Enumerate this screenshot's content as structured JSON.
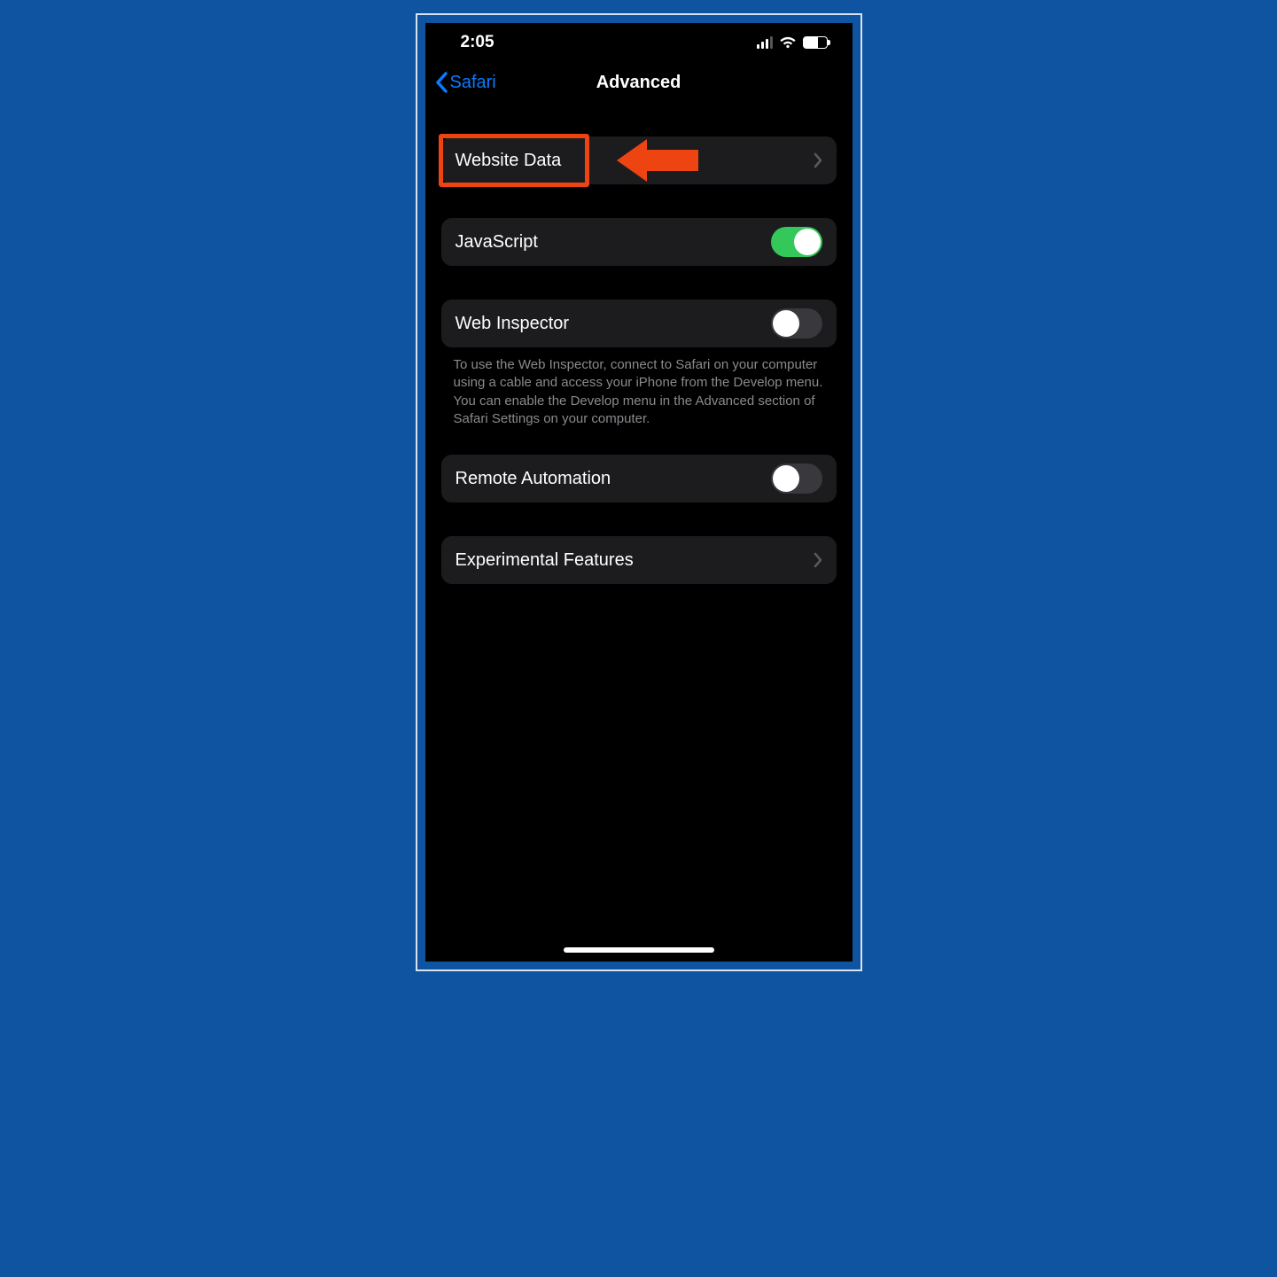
{
  "status": {
    "time": "2:05"
  },
  "nav": {
    "back_label": "Safari",
    "title": "Advanced"
  },
  "rows": {
    "website_data": "Website Data",
    "javascript": "JavaScript",
    "web_inspector": "Web Inspector",
    "remote_automation": "Remote Automation",
    "experimental": "Experimental Features"
  },
  "toggles": {
    "javascript": true,
    "web_inspector": false,
    "remote_automation": false
  },
  "notes": {
    "web_inspector": "To use the Web Inspector, connect to Safari on your computer using a cable and access your iPhone from the Develop menu. You can enable the Develop menu in the Advanced section of Safari Settings on your computer."
  },
  "annotation": {
    "highlight_target": "website_data"
  }
}
